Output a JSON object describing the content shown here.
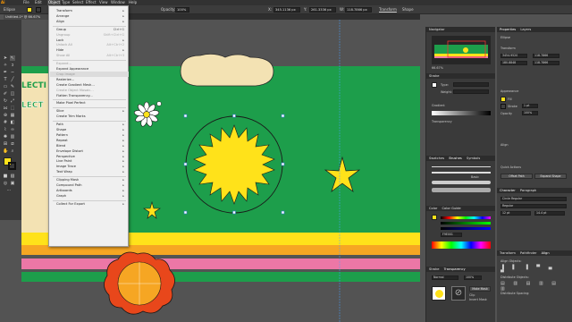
{
  "app": {
    "logo": "Ai"
  },
  "menubar": [
    {
      "label": "File"
    },
    {
      "label": "Edit"
    },
    {
      "label": "Object"
    },
    {
      "label": "Type"
    },
    {
      "label": "Select"
    },
    {
      "label": "Effect"
    },
    {
      "label": "View"
    },
    {
      "label": "Window"
    },
    {
      "label": "Help"
    }
  ],
  "control_bar": {
    "selection": "Ellipse",
    "opacity_label": "Opacity:",
    "opacity": "100%",
    "x": "X:",
    "x_val": "345.1136 px",
    "y": "Y:",
    "y_val": "261.3336 px",
    "w": "W:",
    "w_val": "118.7866 px",
    "transform_label": "Transform",
    "shape_label": "Shape"
  },
  "document_tab": "Untitled-1* @ 66.67%",
  "object_menu": {
    "items": [
      {
        "label": "Transform",
        "arrow": "▸",
        "disabled": false
      },
      {
        "label": "Arrange",
        "arrow": "▸",
        "disabled": false
      },
      {
        "label": "Align",
        "arrow": "▸",
        "disabled": false
      },
      {
        "sep": true
      },
      {
        "label": "Group",
        "shortcut": "Ctrl+G",
        "disabled": false
      },
      {
        "label": "Ungroup",
        "shortcut": "Shift+Ctrl+G",
        "disabled": true
      },
      {
        "label": "Lock",
        "arrow": "▸",
        "disabled": false
      },
      {
        "label": "Unlock All",
        "shortcut": "Alt+Ctrl+2",
        "disabled": true
      },
      {
        "label": "Hide",
        "arrow": "▸",
        "disabled": false
      },
      {
        "label": "Show All",
        "shortcut": "Alt+Ctrl+3",
        "disabled": true
      },
      {
        "sep": true
      },
      {
        "label": "Expand...",
        "disabled": true
      },
      {
        "label": "Expand Appearance",
        "disabled": false
      },
      {
        "label": "Crop Image",
        "disabled": true
      },
      {
        "label": "Rasterize...",
        "disabled": false
      },
      {
        "label": "Create Gradient Mesh...",
        "disabled": false
      },
      {
        "label": "Create Object Mosaic...",
        "disabled": true
      },
      {
        "label": "Flatten Transparency...",
        "disabled": false
      },
      {
        "sep": true
      },
      {
        "label": "Make Pixel Perfect",
        "disabled": false
      },
      {
        "sep": true
      },
      {
        "label": "Slice",
        "arrow": "▸",
        "disabled": false
      },
      {
        "label": "Create Trim Marks",
        "disabled": false
      },
      {
        "sep": true
      },
      {
        "label": "Path",
        "arrow": "▸",
        "disabled": false
      },
      {
        "label": "Shape",
        "arrow": "▸",
        "disabled": false
      },
      {
        "label": "Pattern",
        "arrow": "▸",
        "disabled": false
      },
      {
        "label": "Repeat",
        "arrow": "▸",
        "disabled": false
      },
      {
        "label": "Blend",
        "arrow": "▸",
        "disabled": false
      },
      {
        "label": "Envelope Distort",
        "arrow": "▸",
        "disabled": false
      },
      {
        "label": "Perspective",
        "arrow": "▸",
        "disabled": false
      },
      {
        "label": "Live Paint",
        "arrow": "▸",
        "disabled": false
      },
      {
        "label": "Image Trace",
        "arrow": "▸",
        "disabled": false
      },
      {
        "label": "Text Wrap",
        "arrow": "▸",
        "disabled": false
      },
      {
        "sep": true
      },
      {
        "label": "Clipping Mask",
        "arrow": "▸",
        "disabled": false
      },
      {
        "label": "Compound Path",
        "arrow": "▸",
        "disabled": false
      },
      {
        "label": "Artboards",
        "arrow": "▸",
        "disabled": false
      },
      {
        "label": "Graph",
        "arrow": "▸",
        "disabled": false
      },
      {
        "sep": true
      },
      {
        "label": "Collect For Export",
        "arrow": "▸",
        "disabled": false
      }
    ]
  },
  "artwork": {
    "left_text_1": "LECTI",
    "left_text_2": "LECT",
    "colors": {
      "green": "#1d9e4b",
      "yellow": "#ffe21a",
      "orange": "#f6a623",
      "pink": "#ec77a6",
      "cream": "#f3e2b3",
      "red": "#e8471b"
    }
  },
  "navigator": {
    "title": "Navigator",
    "zoom": "66.67%"
  },
  "properties": {
    "tabs": [
      "Properties",
      "Layers"
    ],
    "object": "Ellipse",
    "transform": "Transform",
    "x": "3454.9520",
    "y": "180.8848",
    "w": "118.7866",
    "h": "118.7866",
    "appearance": "Appearance",
    "fill": "Fill",
    "stroke": "Stroke",
    "stroke_weight": "1 pt",
    "opacity": "Opacity",
    "opacity_val": "100%",
    "align": "Align",
    "quick_actions": "Quick Actions",
    "offset_path": "Offset Path",
    "expand_shape": "Expand Shape"
  },
  "stroke_panel": {
    "title": "Stroke",
    "type": "Type:",
    "weight": "Weight:",
    "gradient": "Gradient",
    "transparency": "Transparency"
  },
  "brushes": {
    "tabs": [
      "Swatches",
      "Brushes",
      "Symbols"
    ],
    "basic": "Basic"
  },
  "color_panel": {
    "tabs": [
      "Color",
      "Color Guide"
    ],
    "hex": "F9E001"
  },
  "character": {
    "tabs": [
      "Character",
      "Paragraph"
    ],
    "font": "Circle Regular",
    "style": "Regular",
    "size": "12 pt",
    "leading": "14.4 pt"
  },
  "transparency": {
    "tabs": [
      "Stroke",
      "Transparency"
    ],
    "mode": "Normal",
    "opacity": "100%",
    "make_mask": "Make Mask",
    "clip": "Clip",
    "invert": "Invert Mask"
  },
  "layers": {
    "tabs": [
      "Transform",
      "Pathfinder",
      "Align"
    ],
    "align_label": "Align Objects:",
    "distribute": "Distribute Objects:",
    "spacing": "Distribute Spacing:"
  }
}
